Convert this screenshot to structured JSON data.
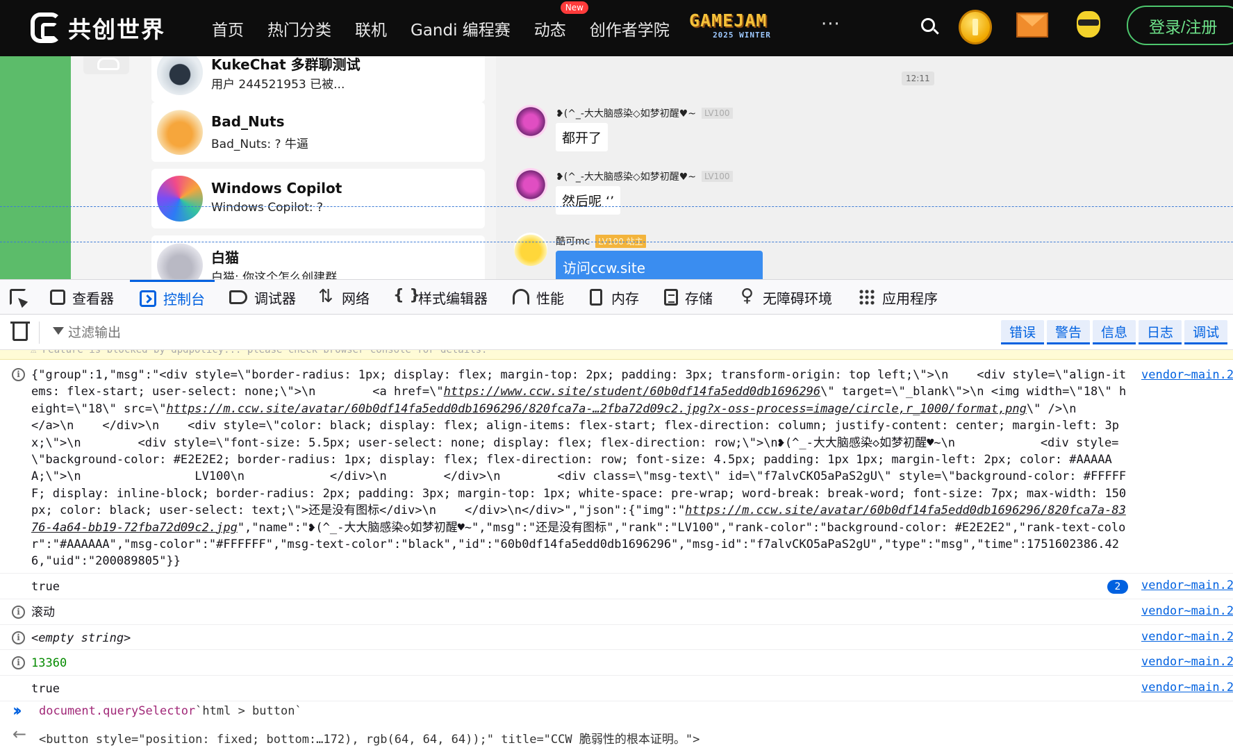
{
  "topbar": {
    "logo_text": "共创世界",
    "nav": [
      "首页",
      "热门分类",
      "联机",
      "Gandi 编程赛",
      "动态",
      "创作者学院"
    ],
    "new_badge": "New",
    "gamejam_line1": "GAMEJAM",
    "gamejam_line2": "2025 WINTER",
    "more": "···",
    "login": "登录/注册"
  },
  "chat": {
    "conversations": [
      {
        "name": "KukeChat 多群聊测试",
        "preview": "用户 244521953 已被..."
      },
      {
        "name": "Bad_Nuts",
        "preview": "Bad_Nuts: ? 牛逼"
      },
      {
        "name": "Windows Copilot",
        "preview": "Windows Copilot: ?"
      },
      {
        "name": "白猫",
        "preview": "白猫: 你这个怎么创建群..."
      }
    ],
    "time": "12:11",
    "messages": [
      {
        "sender": "❥(^_-大大脑感染◇如梦初醒♥~",
        "rank": "LV100",
        "text": "都开了"
      },
      {
        "sender": "❥(^_-大大脑感染◇如梦初醒♥~",
        "rank": "LV100",
        "text": "然后呢 ‘’"
      },
      {
        "sender": "酷可mc",
        "rank": "LV100 站主",
        "text": "访问ccw.site"
      }
    ]
  },
  "devtools": {
    "tools": [
      "查看器",
      "控制台",
      "调试器",
      "网络",
      "样式编辑器",
      "性能",
      "内存",
      "存储",
      "无障碍环境",
      "应用程序"
    ],
    "filter_placeholder": "过滤输出",
    "levels": [
      "错误",
      "警告",
      "信息",
      "日志",
      "调试"
    ]
  },
  "console": {
    "warn_text": "⚠ Feature is blocked by dpdpolicy... please check browser console for details.",
    "source": "vendor~main.2",
    "log_json": {
      "p1": "{\"group\":1,\"msg\":\"<div style=\\\"border-radius: 1px; display: flex; margin-top: 2px; padding: 3px; transform-origin: top left;\\\">\\n    <div style=\\\"align-items: flex-start; user-select: none;\\\">\\n        <a href=\\\"",
      "link1": "https://www.ccw.site/student/60b0df14fa5edd0db1696296",
      "p2": "\\\" target=\\\"_blank\\\">\\n <img width=\\\"18\\\" height=\\\"18\\\" src=\\\"",
      "link2": "https://m.ccw.site/avatar/60b0df14fa5edd0db1696296/820fca7a-…2fba72d09c2.jpg?x-oss-process=image/circle,r_1000/format,png",
      "p3": "\\\" />\\n        </a>\\n    </div>\\n    <div style=\\\"color: black; display: flex; align-items: flex-start; flex-direction: column; justify-content: center; margin-left: 3px;\\\">\\n        <div style=\\\"font-size: 5.5px; user-select: none; display: flex; flex-direction: row;\\\">\\n❥(^_-大大脑感染◇如梦初醒♥~\\n            <div style=\\\"background-color: #E2E2E2; border-radius: 1px; display: flex; flex-direction: row; font-size: 4.5px; padding: 1px 1px; margin-left: 2px; color: #AAAAAA;\\\">\\n                LV100\\n            </div>\\n        </div>\\n        <div class=\\\"msg-text\\\" id=\\\"f7alvCKO5aPaS2gU\\\" style=\\\"background-color: #FFFFFF; display: inline-block; border-radius: 2px; padding: 3px; margin-top: 1px; white-space: pre-wrap; word-break: break-word; font-size: 7px; max-width: 150px; color: black; user-select: text;\\\">还是没有图标</div>\\n    </div>\\n</div>\",\"json\":{\"img\":\"",
      "link3": "https://m.ccw.site/avatar/60b0df14fa5edd0db1696296/820fca7a-8376-4a64-bb19-72fba72d09c2.jpg",
      "p4": "\",\"name\":\"❥(^_-大大脑感染◇如梦初醒♥~\",\"msg\":\"还是没有图标\",\"rank\":\"LV100\",\"rank-color\":\"background-color: #E2E2E2\",\"rank-text-color\":\"#AAAAAA\",\"msg-color\":\"#FFFFFF\",\"msg-text-color\":\"black\",\"id\":\"60b0df14fa5edd0db1696296\",\"msg-id\":\"f7alvCKO5aPaS2gU\",\"type\":\"msg\",\"time\":1751602386.426,\"uid\":\"200089805\"}}"
    },
    "rows": [
      {
        "text": "true",
        "badge": "2"
      },
      {
        "text": "滚动"
      },
      {
        "text": "<empty string>"
      },
      {
        "text": "13360"
      },
      {
        "text": "true"
      }
    ],
    "prompt_cmd_a": "document.querySelector",
    "prompt_cmd_b": "`html > button`",
    "result": "<button style=\"position: fixed; bottom:…172), rgb(64, 64, 64));\" title=\"CCW 脆弱性的根本证明。\">"
  },
  "colors": {
    "accent": "#0061e0",
    "login_green": "#4dc66d",
    "chat_green": "#5cbc6a"
  }
}
